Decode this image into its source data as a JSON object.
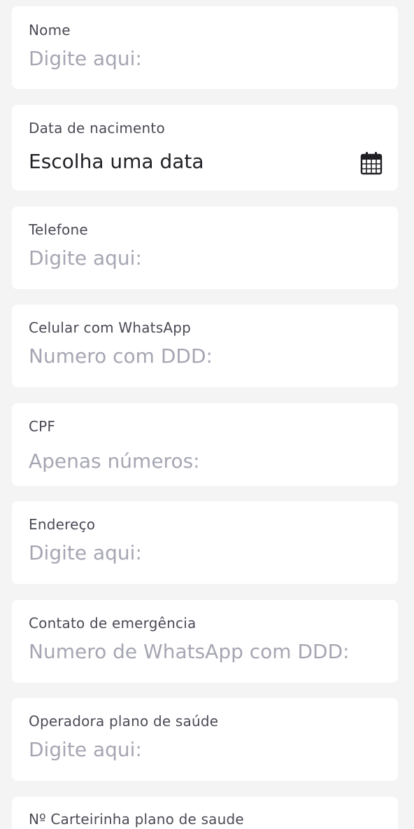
{
  "form": {
    "fields": [
      {
        "label": "Nome",
        "placeholder": "Digite aqui:"
      },
      {
        "label": "Data de nacimento",
        "value": "Escolha uma data",
        "icon": "calendar-icon"
      },
      {
        "label": "Telefone",
        "placeholder": "Digite aqui:"
      },
      {
        "label": "Celular com WhatsApp",
        "placeholder": "Numero com DDD:"
      },
      {
        "label": "CPF",
        "placeholder": "Apenas números:"
      },
      {
        "label": "Endereço",
        "placeholder": "Digite aqui:"
      },
      {
        "label": "Contato de emergência",
        "placeholder": "Numero de WhatsApp com DDD:"
      },
      {
        "label": "Operadora plano de saúde",
        "placeholder": "Digite aqui:"
      },
      {
        "label": "Nº Carteirinha plano de saude"
      }
    ]
  },
  "colors": {
    "background": "#f4f4f5",
    "card": "#ffffff",
    "label": "#4a4a55",
    "placeholder": "#a6a6b3",
    "text": "#1f1f24"
  }
}
